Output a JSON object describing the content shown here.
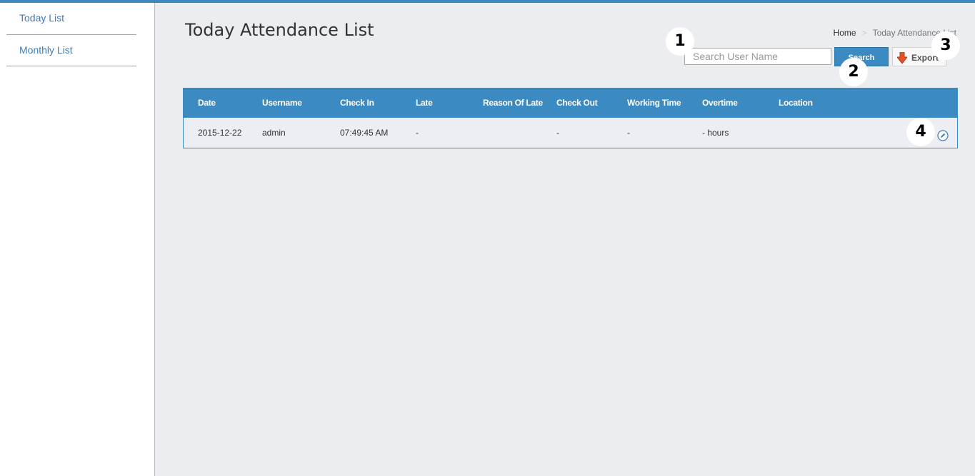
{
  "sidebar": {
    "items": [
      {
        "label": "Today List"
      },
      {
        "label": "Monthly List"
      }
    ]
  },
  "page": {
    "title": "Today Attendance List"
  },
  "breadcrumb": {
    "home": "Home",
    "separator": ">",
    "current": "Today Attendance List"
  },
  "toolbar": {
    "search_placeholder": "Search User Name",
    "search_value": "",
    "search_label": "Search",
    "export_label": "Export"
  },
  "badges": [
    "1",
    "2",
    "3",
    "4"
  ],
  "table": {
    "columns": [
      "Date",
      "Username",
      "Check In",
      "Late",
      "Reason Of Late",
      "Check Out",
      "Working Time",
      "Overtime",
      "Location"
    ],
    "rows": [
      [
        "2015-12-22",
        "admin",
        "07:49:45 AM",
        "-",
        "",
        "-",
        "-",
        "- hours",
        ""
      ]
    ]
  },
  "icons": {
    "export": "down-arrow-icon",
    "edit": "pencil-edit-icon"
  },
  "colors": {
    "accent": "#3b8ac2",
    "link": "#3b7cb8",
    "background": "#ecedf0"
  }
}
